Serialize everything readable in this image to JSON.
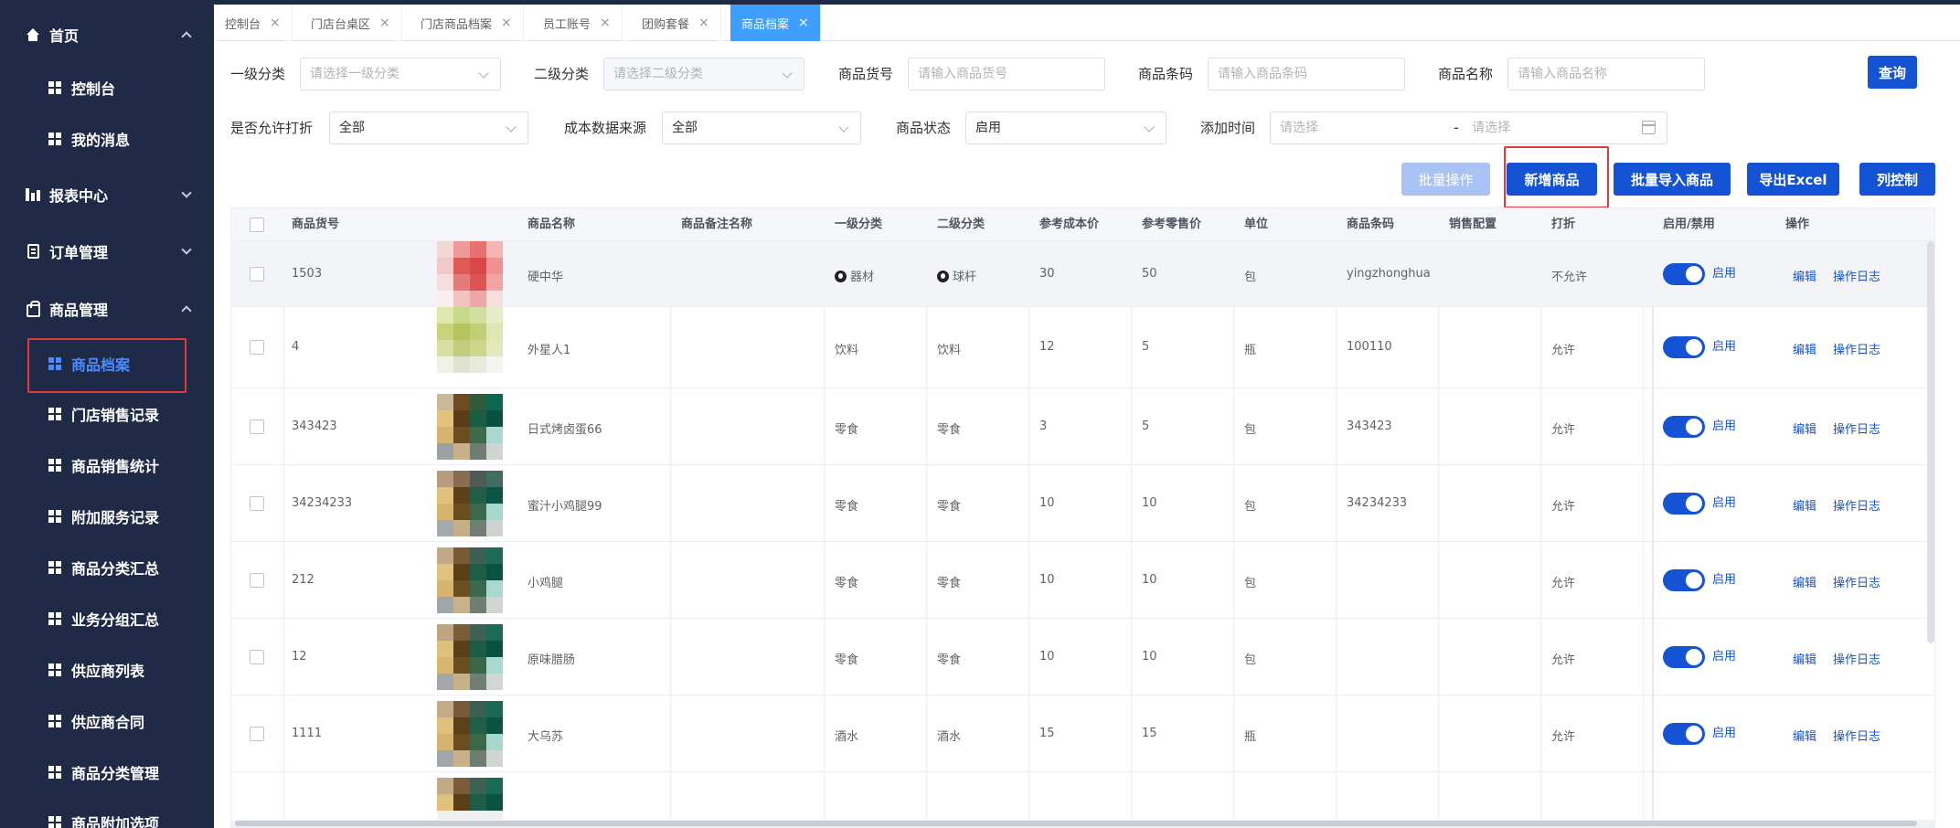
{
  "sidebar": {
    "items": [
      {
        "label": "首页",
        "kind": "group",
        "icon": "home-icon",
        "expanded": true
      },
      {
        "label": "控制台",
        "kind": "sub"
      },
      {
        "label": "我的消息",
        "kind": "sub"
      },
      {
        "label": "报表中心",
        "kind": "group",
        "icon": "chart-icon",
        "expanded": false
      },
      {
        "label": "订单管理",
        "kind": "group",
        "icon": "document-icon",
        "expanded": false
      },
      {
        "label": "商品管理",
        "kind": "group",
        "icon": "bag-icon",
        "expanded": true
      },
      {
        "label": "商品档案",
        "kind": "sub",
        "active": true
      },
      {
        "label": "门店销售记录",
        "kind": "sub"
      },
      {
        "label": "商品销售统计",
        "kind": "sub"
      },
      {
        "label": "附加服务记录",
        "kind": "sub"
      },
      {
        "label": "商品分类汇总",
        "kind": "sub"
      },
      {
        "label": "业务分组汇总",
        "kind": "sub"
      },
      {
        "label": "供应商列表",
        "kind": "sub"
      },
      {
        "label": "供应商合同",
        "kind": "sub"
      },
      {
        "label": "商品分类管理",
        "kind": "sub"
      },
      {
        "label": "商品附加选项",
        "kind": "sub"
      }
    ]
  },
  "tabs": [
    {
      "label": "控制台"
    },
    {
      "label": "门店台桌区"
    },
    {
      "label": "门店商品档案"
    },
    {
      "label": "员工账号"
    },
    {
      "label": "团购套餐"
    },
    {
      "label": "商品档案",
      "active": true
    }
  ],
  "filters": {
    "category1": {
      "label": "一级分类",
      "placeholder": "请选择一级分类"
    },
    "category2": {
      "label": "二级分类",
      "placeholder": "请选择二级分类"
    },
    "code": {
      "label": "商品货号",
      "placeholder": "请输入商品货号"
    },
    "barcode": {
      "label": "商品条码",
      "placeholder": "请输入商品条码"
    },
    "name": {
      "label": "商品名称",
      "placeholder": "请输入商品名称"
    },
    "query_label": "查询",
    "discount": {
      "label": "是否允许打折",
      "value": "全部"
    },
    "cost_source": {
      "label": "成本数据来源",
      "value": "全部"
    },
    "status": {
      "label": "商品状态",
      "value": "启用"
    },
    "add_time": {
      "label": "添加时间",
      "start_placeholder": "请选择",
      "separator": "-",
      "end_placeholder": "请选择"
    }
  },
  "actions": {
    "batch": "批量操作",
    "add": "新增商品",
    "import": "批量导入商品",
    "export": "导出Excel",
    "columns": "列控制"
  },
  "table": {
    "headers": {
      "code": "商品货号",
      "name": "商品名称",
      "remark": "商品备注名称",
      "cat1": "一级分类",
      "cat2": "二级分类",
      "cost": "参考成本价",
      "price": "参考零售价",
      "unit": "单位",
      "barcode": "商品条码",
      "sales_config": "销售配置",
      "discount": "打折",
      "enabled": "启用/禁用",
      "ops": "操作"
    },
    "switch_label": "启用",
    "edit_label": "编辑",
    "log_label": "操作日志",
    "rows": [
      {
        "code": "1503",
        "name": "硬中华",
        "cat1": "器材",
        "cat2": "球杆",
        "cost": "30",
        "price": "50",
        "unit": "包",
        "barcode": "yingzhonghua",
        "discount": "不允许",
        "enabled": true
      },
      {
        "code": "4",
        "name": "外星人1",
        "cat1": "饮料",
        "cat2": "饮料",
        "cost": "12",
        "price": "5",
        "unit": "瓶",
        "barcode": "100110",
        "discount": "允许",
        "enabled": true
      },
      {
        "code": "343423",
        "name": "日式烤卤蛋66",
        "cat1": "零食",
        "cat2": "零食",
        "cost": "3",
        "price": "5",
        "unit": "包",
        "barcode": "343423",
        "discount": "允许",
        "enabled": true
      },
      {
        "code": "34234233",
        "name": "蜜汁小鸡腿99",
        "cat1": "零食",
        "cat2": "零食",
        "cost": "10",
        "price": "10",
        "unit": "包",
        "barcode": "34234233",
        "discount": "允许",
        "enabled": true
      },
      {
        "code": "212",
        "name": "小鸡腿",
        "cat1": "零食",
        "cat2": "零食",
        "cost": "10",
        "price": "10",
        "unit": "包",
        "barcode": "",
        "discount": "允许",
        "enabled": true
      },
      {
        "code": "12",
        "name": "原味腊肠",
        "cat1": "零食",
        "cat2": "零食",
        "cost": "10",
        "price": "10",
        "unit": "包",
        "barcode": "",
        "discount": "允许",
        "enabled": true
      },
      {
        "code": "1111",
        "name": "大乌苏",
        "cat1": "酒水",
        "cat2": "酒水",
        "cost": "15",
        "price": "15",
        "unit": "瓶",
        "barcode": "",
        "discount": "允许",
        "enabled": true
      }
    ]
  },
  "colors": {
    "sidebar_bg": "#1f2a47",
    "primary": "#1453d4",
    "active_tab": "#409eff",
    "highlight": "#e23a3a"
  }
}
